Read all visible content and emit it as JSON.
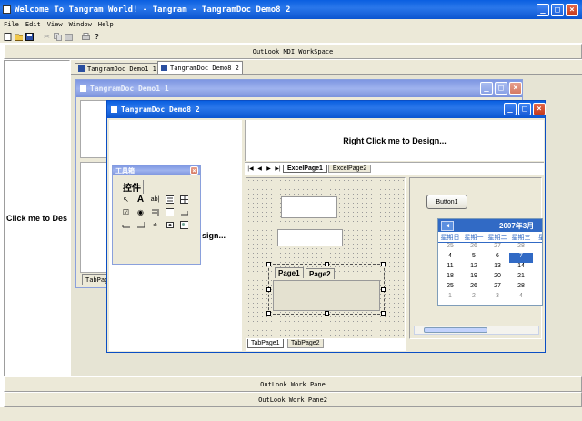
{
  "app": {
    "title": "Welcome To Tangram World! - Tangram - TangramDoc Demo8 2"
  },
  "menu": [
    "File",
    "Edit",
    "View",
    "Window",
    "Help"
  ],
  "toolbar_icons": [
    "new-file-icon",
    "open-folder-icon",
    "save-icon",
    "cut-icon",
    "copy-icon",
    "paste-icon",
    "print-icon",
    "help-icon"
  ],
  "workspace_bar": "OutLook MDI WorkSpace",
  "left_pane": {
    "label": "Click me to Des"
  },
  "mdi_tabs": [
    {
      "label": "TangramDoc Demo1 1"
    },
    {
      "label": "TangramDoc Demo8 2"
    }
  ],
  "doc1": {
    "title": "TangramDoc Demo1 1",
    "tab_label": "TabPag"
  },
  "doc8": {
    "title": "TangramDoc Demo8 2",
    "left_text": "sign...",
    "right_header": "Right Click me to Design...",
    "sheet_nav": [
      "|◀",
      "◀",
      "▶",
      "▶|"
    ],
    "sheet_tabs": [
      "ExcelPage1",
      "ExcelPage2"
    ],
    "inner_tabs": [
      "Page1",
      "Page2"
    ],
    "button1": "Button1",
    "bottom_tabs": [
      "TabPage1",
      "TabPage2"
    ]
  },
  "toolbox": {
    "title": "工具箱",
    "tab": "控件",
    "tools": [
      "pointer-icon",
      "label-tool-icon",
      "textbox-tool-icon",
      "frame-tool-icon",
      "grid-tool-icon",
      "checkbox-tool-icon",
      "radio-tool-icon",
      "combobox-tool-icon",
      "listbox-tool-icon",
      "scrollbar-tool-icon",
      "hscroll-tool-icon",
      "vscroll-tool-icon",
      "spin-tool-icon",
      "tab-tool-icon",
      "image-tool-icon"
    ]
  },
  "calendar": {
    "title": "2007年3月",
    "headers": [
      "星期日",
      "星期一",
      "星期二",
      "星期三",
      "星期"
    ],
    "rows": [
      [
        "25",
        "26",
        "27",
        "28",
        "1"
      ],
      [
        "4",
        "5",
        "6",
        "7",
        "8"
      ],
      [
        "11",
        "12",
        "13",
        "14",
        "1"
      ],
      [
        "18",
        "19",
        "20",
        "21",
        "2"
      ],
      [
        "25",
        "26",
        "27",
        "28",
        "2"
      ],
      [
        "1",
        "2",
        "3",
        "4",
        "5"
      ]
    ],
    "selected": "7"
  },
  "panes": [
    "OutLook Work Pane",
    "OutLook Work Pane2"
  ],
  "colors": {
    "title_active": "#0a5fe0",
    "title_inactive": "#8fa7e8",
    "face": "#ece9d8",
    "calendar_header": "#316ac5"
  }
}
